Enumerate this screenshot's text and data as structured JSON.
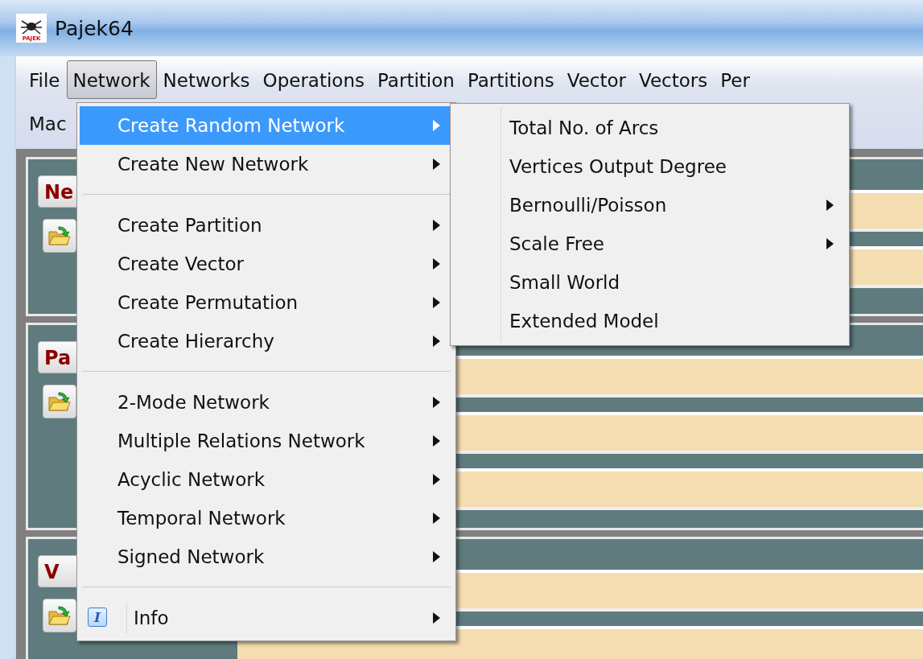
{
  "window": {
    "title": "Pajek64",
    "logo_text": "PAJEK"
  },
  "menubar": {
    "rows": [
      [
        {
          "label": "File",
          "selected": false
        },
        {
          "label": "Network",
          "selected": true
        },
        {
          "label": "Networks",
          "selected": false
        },
        {
          "label": "Operations",
          "selected": false
        },
        {
          "label": "Partition",
          "selected": false
        },
        {
          "label": "Partitions",
          "selected": false
        },
        {
          "label": "Vector",
          "selected": false
        },
        {
          "label": "Vectors",
          "selected": false
        },
        {
          "label": "Per",
          "selected": false
        }
      ],
      [
        {
          "label": "Mac",
          "selected": false
        }
      ]
    ]
  },
  "menu": {
    "items": [
      {
        "kind": "item",
        "label": "Create Random Network",
        "submenu": true,
        "selected": true
      },
      {
        "kind": "item",
        "label": "Create New Network",
        "submenu": true,
        "selected": false
      },
      {
        "kind": "separator"
      },
      {
        "kind": "item",
        "label": "Create Partition",
        "submenu": true,
        "selected": false
      },
      {
        "kind": "item",
        "label": "Create Vector",
        "submenu": true,
        "selected": false
      },
      {
        "kind": "item",
        "label": "Create Permutation",
        "submenu": true,
        "selected": false
      },
      {
        "kind": "item",
        "label": "Create Hierarchy",
        "submenu": true,
        "selected": false
      },
      {
        "kind": "separator"
      },
      {
        "kind": "item",
        "label": "2-Mode Network",
        "submenu": true,
        "selected": false
      },
      {
        "kind": "item",
        "label": "Multiple Relations Network",
        "submenu": true,
        "selected": false
      },
      {
        "kind": "item",
        "label": "Acyclic Network",
        "submenu": true,
        "selected": false
      },
      {
        "kind": "item",
        "label": "Temporal Network",
        "submenu": true,
        "selected": false
      },
      {
        "kind": "item",
        "label": "Signed Network",
        "submenu": true,
        "selected": false
      },
      {
        "kind": "separator"
      },
      {
        "kind": "info",
        "label": "Info",
        "icon_text": "I",
        "submenu": true,
        "selected": false
      }
    ]
  },
  "submenu": {
    "items": [
      {
        "label": "Total No. of Arcs",
        "submenu": false,
        "selected": false
      },
      {
        "label": "Vertices Output Degree",
        "submenu": false,
        "selected": false
      },
      {
        "label": "Bernoulli/Poisson",
        "submenu": true,
        "selected": false
      },
      {
        "label": "Scale Free",
        "submenu": true,
        "selected": false
      },
      {
        "label": "Small World",
        "submenu": false,
        "selected": false
      },
      {
        "label": "Extended Model",
        "submenu": false,
        "selected": false
      }
    ]
  },
  "panels": [
    {
      "label": "Ne"
    },
    {
      "label": "Pa"
    },
    {
      "label": "V"
    }
  ]
}
